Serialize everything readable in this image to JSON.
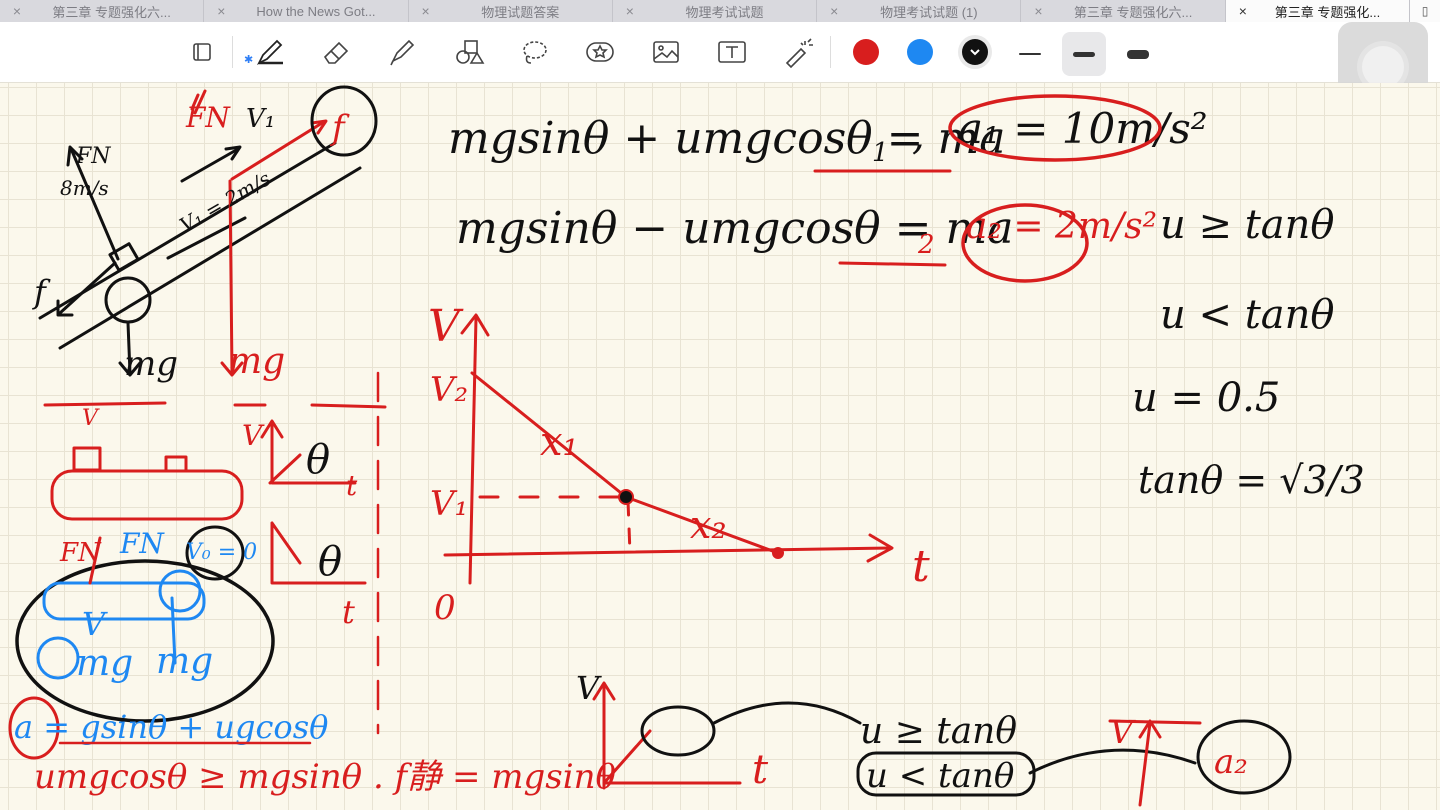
{
  "tabs": [
    {
      "label": "第三章 专题强化六...",
      "active": false
    },
    {
      "label": "How the News Got...",
      "active": false
    },
    {
      "label": "物理试题答案",
      "active": false
    },
    {
      "label": "物理考试试题",
      "active": false
    },
    {
      "label": "物理考试试题 (1)",
      "active": false
    },
    {
      "label": "第三章 专题强化六...",
      "active": false
    },
    {
      "label": "第三章 专题强化...",
      "active": true
    }
  ],
  "tab_close_glyph": "×",
  "toolbar": {
    "tools": [
      "pages-icon",
      "pen-icon",
      "eraser-icon",
      "highlighter-icon",
      "shapes-icon",
      "lasso-icon",
      "sticker-icon",
      "image-icon",
      "text-icon",
      "laser-pointer-icon"
    ],
    "colors": [
      "#d81e1e",
      "#1e88f2",
      "#111111"
    ],
    "selected_color": "#111111",
    "stroke_widths": [
      "thin",
      "medium",
      "thick"
    ],
    "selected_stroke": "medium"
  },
  "notes": {
    "eq1_left": "mgsinθ + umgcosθ = ma",
    "eq1_sub": "1",
    "eq1_result": "a₁ = 10m/s²",
    "eq2_left": "mgsinθ − umgcosθ = ma",
    "eq2_sub": "2",
    "eq2_result": "a₂ = 2m/s²",
    "cond_ge": "u ≥ tanθ",
    "cond_lt": "u < tanθ",
    "mu_value": "u = 0.5",
    "tan_value": "tanθ = √3/3",
    "diagram_labels": {
      "fn": "FN",
      "f": "f",
      "mg": "mg",
      "v1": "V₁",
      "v1_speed": "V₁ = 2m/s",
      "speed8": "8m/s",
      "force_label": "f"
    },
    "graph_labels": {
      "v": "V",
      "t": "t",
      "v1": "V₁",
      "v2": "V₂",
      "x1": "x₁",
      "x2": "x₂",
      "origin": "0"
    },
    "bottom_left_eq": "a = gsinθ + ugcosθ",
    "bottom_cond": "umgcosθ ≥ mgsinθ . f静 = mgsinθ",
    "bottom_right_cond_ge": "u ≥ tanθ",
    "bottom_right_cond_lt": "u < tanθ",
    "bottom_right_a2": "a₂",
    "v0_label": "V₀ = 0",
    "small_v": "V",
    "small_theta": "θ"
  }
}
